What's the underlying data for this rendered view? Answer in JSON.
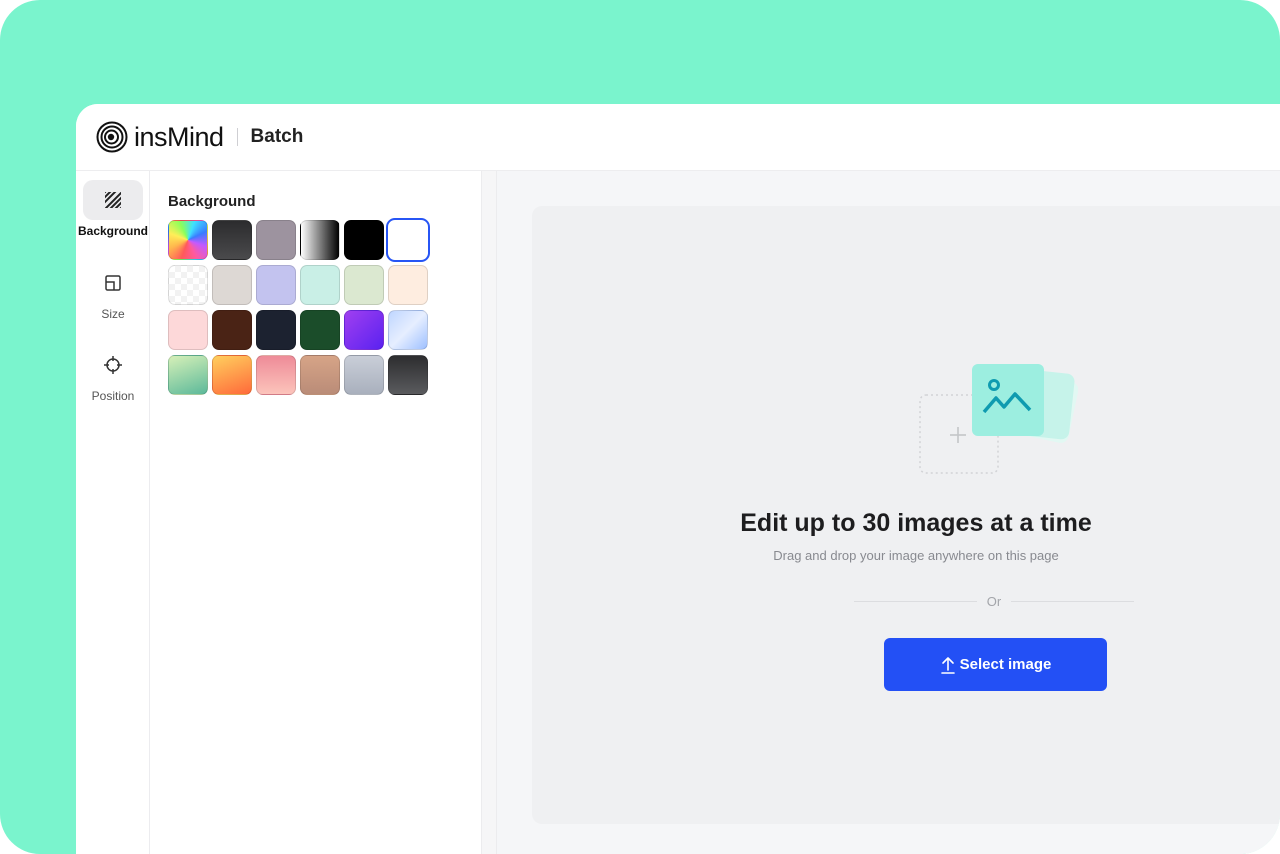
{
  "header": {
    "brand": "insMind",
    "section": "Batch"
  },
  "rail": {
    "items": [
      {
        "id": "background",
        "label": "Background",
        "icon": "hatched-square-icon",
        "active": true
      },
      {
        "id": "size",
        "label": "Size",
        "icon": "resize-icon",
        "active": false
      },
      {
        "id": "position",
        "label": "Position",
        "icon": "crosshair-icon",
        "active": false
      }
    ]
  },
  "panel": {
    "title": "Background",
    "swatches": [
      {
        "name": "rainbow",
        "bg": "conic-gradient(from 200deg, #ff5a5a, #ffb74d, #ffee58, #8bff5a, #3fe0ff, #3a7bff, #c35aff, #ff5a9e, #ff5a5a)"
      },
      {
        "name": "charcoal",
        "bg": "linear-gradient(180deg, #2c2c2e, #4a4a4c)"
      },
      {
        "name": "mauve-gray",
        "bg": "#9d939f"
      },
      {
        "name": "white-black-gradient",
        "bg": "linear-gradient(90deg, #ffffff, #000000)"
      },
      {
        "name": "black",
        "bg": "#000000"
      },
      {
        "name": "white",
        "bg": "#ffffff",
        "selected": true
      },
      {
        "name": "transparent",
        "bg": "repeating-conic-gradient(#f2f2f2 0% 25%, #ffffff 0% 50%) 0 0 / 12px 12px"
      },
      {
        "name": "warm-gray",
        "bg": "#ddd8d4"
      },
      {
        "name": "lavender",
        "bg": "#c3c3ef"
      },
      {
        "name": "mint",
        "bg": "#c9efe6"
      },
      {
        "name": "sage",
        "bg": "#dbe8d0"
      },
      {
        "name": "cream",
        "bg": "#feede0"
      },
      {
        "name": "blush",
        "bg": "#fdd8d9"
      },
      {
        "name": "brown",
        "bg": "#4a2315"
      },
      {
        "name": "navy",
        "bg": "#1c2230"
      },
      {
        "name": "forest",
        "bg": "#1b4d2a"
      },
      {
        "name": "violet",
        "bg": "linear-gradient(135deg, #a03ff0, #5a22f0)"
      },
      {
        "name": "sky-gradient",
        "bg": "linear-gradient(135deg, #bfd6ff, #e6eeff 50%, #9ec0ff)"
      },
      {
        "name": "green-gradient",
        "bg": "linear-gradient(160deg, #d6f0b8, #5cb99a)"
      },
      {
        "name": "orange-gradient",
        "bg": "linear-gradient(160deg, #ffcf5e, #ff6a3a)"
      },
      {
        "name": "pink-gradient",
        "bg": "linear-gradient(180deg, #ee8b98, #fcc4bb)"
      },
      {
        "name": "bronze-gradient",
        "bg": "linear-gradient(180deg, #d6a487, #ba8c78)"
      },
      {
        "name": "silver-gradient",
        "bg": "linear-gradient(180deg, #c9ced8, #a9b0bd)"
      },
      {
        "name": "graphite-gradient",
        "bg": "linear-gradient(180deg, #2d2d2f, #5a5b5e)"
      }
    ]
  },
  "workspace": {
    "headline": "Edit up to 30 images at a time",
    "subline": "Drag and drop your image anywhere on this page",
    "or": "Or",
    "button_label": "Select image"
  },
  "colors": {
    "frame": "#7af4cd",
    "accent": "#2350f5",
    "selected_border": "#2755f5",
    "illustration_teal": "#8ee8d8",
    "illustration_icon": "#0f9bb0"
  }
}
